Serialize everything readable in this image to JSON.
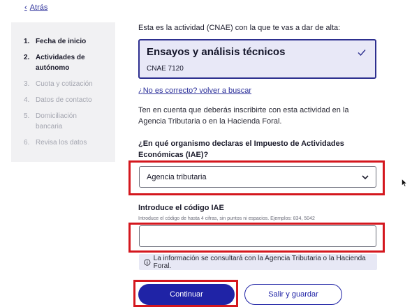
{
  "nav": {
    "back_label": "Atrás"
  },
  "steps": [
    {
      "num": "1.",
      "label": "Fecha de inicio",
      "state": "done"
    },
    {
      "num": "2.",
      "label": "Actividades de autónomo",
      "state": "active"
    },
    {
      "num": "3.",
      "label": "Cuota y cotización",
      "state": "pending"
    },
    {
      "num": "4.",
      "label": "Datos de contacto",
      "state": "pending"
    },
    {
      "num": "5.",
      "label": "Domiciliación bancaria",
      "state": "pending"
    },
    {
      "num": "6.",
      "label": "Revisa los datos",
      "state": "pending"
    }
  ],
  "main": {
    "intro": "Esta es la actividad (CNAE) con la que te vas a dar de alta:",
    "activity": {
      "title": "Ensayos y análisis técnicos",
      "code": "CNAE 7120"
    },
    "wrong_link": "¿No es correcto? volver a buscar",
    "info": "Ten en cuenta que deberás inscribirte con esta actividad en la Agencia Tributaria o en la Hacienda Foral.",
    "question": "¿En qué organismo declaras el Impuesto de Actividades Económicas (IAE)?",
    "select_value": "Agencia tributaria",
    "code_label": "Introduce el código IAE",
    "code_hint": "Introduce el código de hasta 4 cifras, sin puntos ni espacios. Ejemplos: 834, 5042",
    "code_value": "",
    "notice": "La información se consultará con la Agencia Tributaria o la Hacienda Foral."
  },
  "buttons": {
    "continue": "Continuar",
    "save_exit": "Salir y guardar"
  },
  "colors": {
    "primary": "#1f23a6",
    "highlight": "#d4171e",
    "card_bg": "#e8e8f7",
    "sidebar_bg": "#f1f1f3"
  }
}
